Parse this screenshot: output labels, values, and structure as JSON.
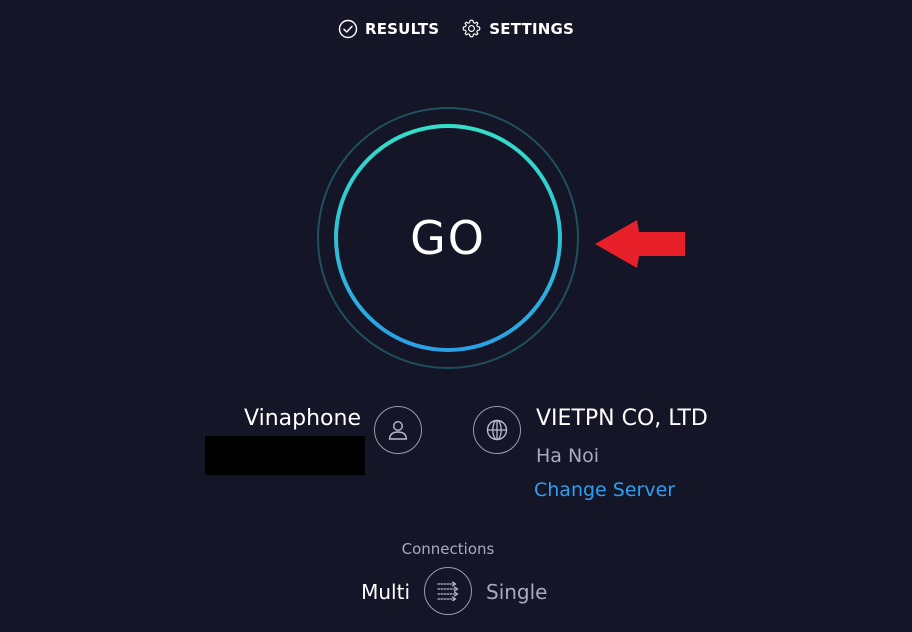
{
  "nav": {
    "results_label": "RESULTS",
    "settings_label": "SETTINGS"
  },
  "go_button": {
    "label": "GO"
  },
  "provider": {
    "name": "Vinaphone"
  },
  "server": {
    "name": "VIETPN CO, LTD",
    "location": "Ha Noi",
    "change_label": "Change Server"
  },
  "connections": {
    "label": "Connections",
    "multi_label": "Multi",
    "single_label": "Single",
    "selected": "Multi"
  },
  "colors": {
    "background": "#141526",
    "ring_top": "#34dfc9",
    "ring_bottom": "#2a9fe6",
    "link": "#2f9ff0",
    "annotation_arrow": "#e8202a"
  },
  "icons": {
    "results": "check-circle-icon",
    "settings": "gear-icon",
    "provider": "user-icon",
    "server": "globe-icon",
    "connections": "multi-connection-icon"
  }
}
